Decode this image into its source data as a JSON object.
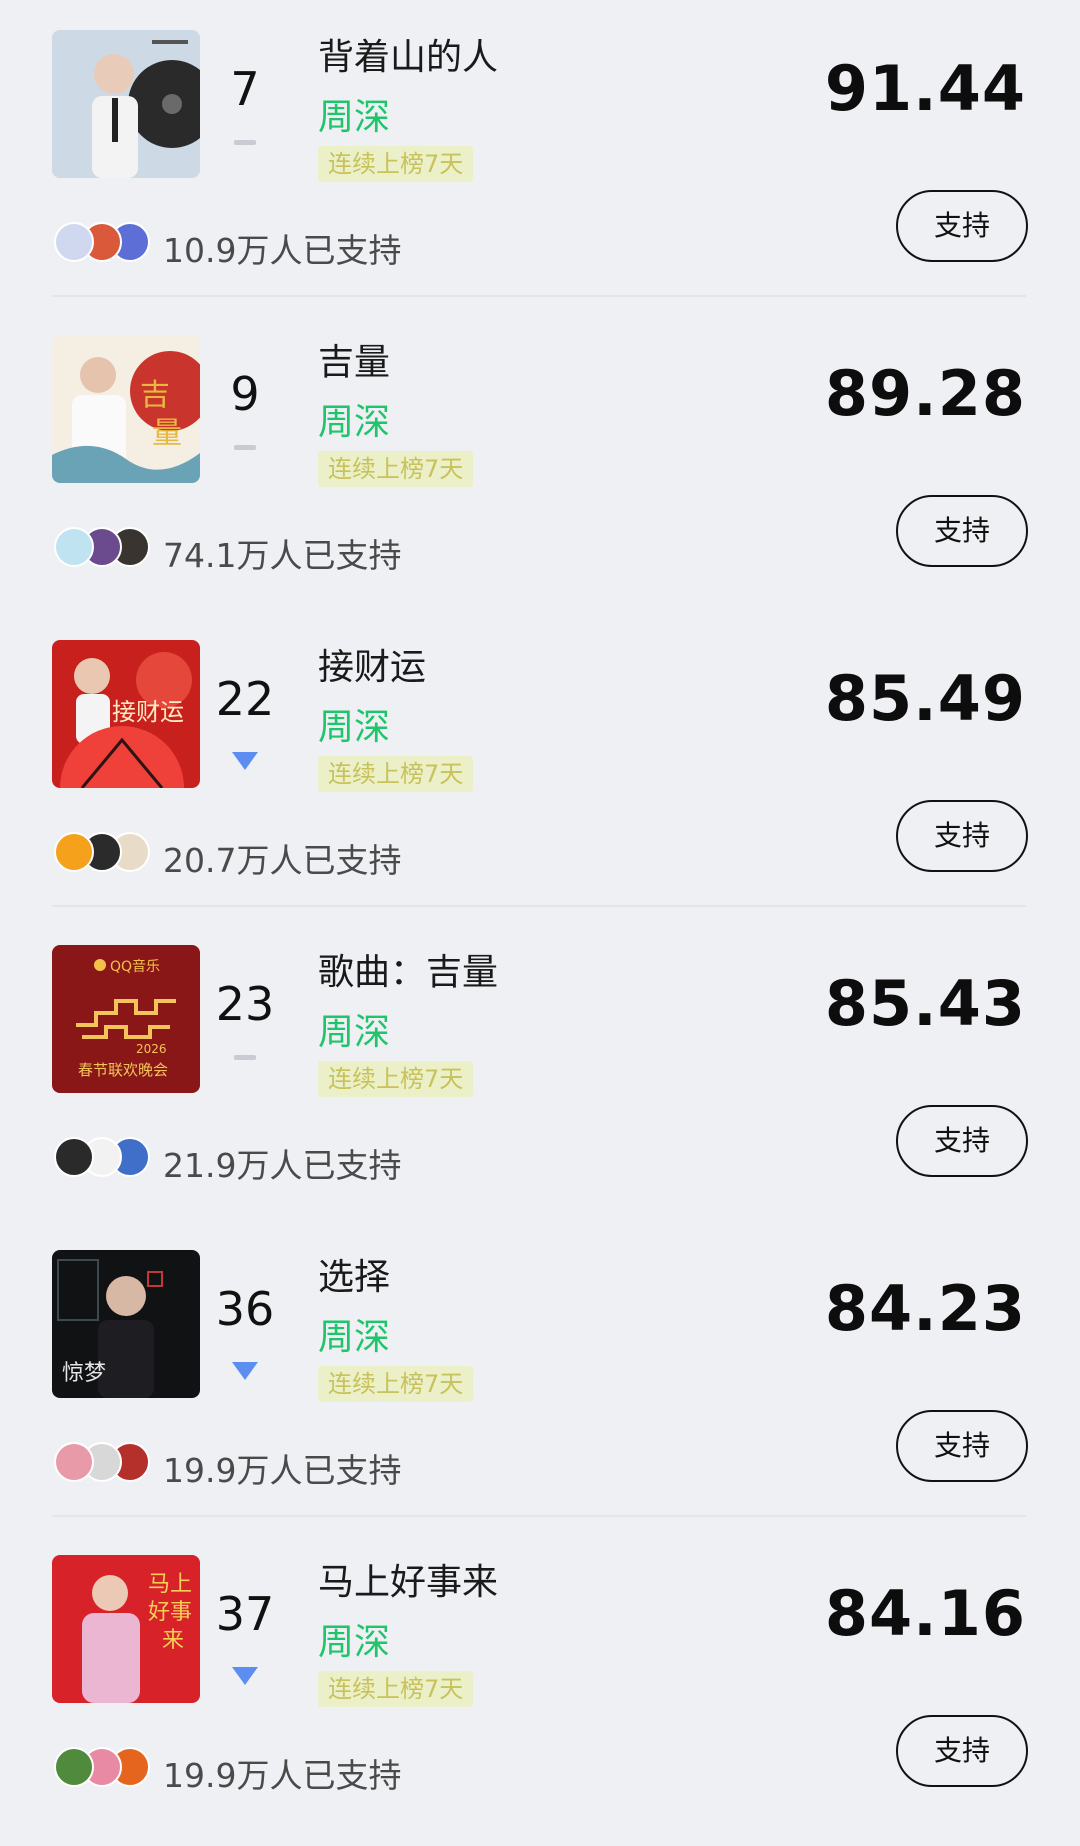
{
  "support_label": "支持",
  "colors": {
    "artist": "#20c46b",
    "streak_bg": "#ecf0c8",
    "streak_text": "#c8c25a",
    "trend_down": "#5b8ef0",
    "background": "#eef0f4"
  },
  "entries": [
    {
      "rank": "7",
      "trend": "flat",
      "song": "背着山的人",
      "artist": "周深",
      "streak": "连续上榜7天",
      "score": "91.44",
      "supporters": "10.9万人已支持",
      "cover": "portrait-cover-beizheshan"
    },
    {
      "rank": "9",
      "trend": "flat",
      "song": "吉量",
      "artist": "周深",
      "streak": "连续上榜7天",
      "score": "89.28",
      "supporters": "74.1万人已支持",
      "cover": "portrait-cover-jiliang"
    },
    {
      "rank": "22",
      "trend": "down",
      "song": "接财运",
      "artist": "周深",
      "streak": "连续上榜7天",
      "score": "85.49",
      "supporters": "20.7万人已支持",
      "cover": "portrait-cover-jiecaiyun"
    },
    {
      "rank": "23",
      "trend": "flat",
      "song": "歌曲：吉量",
      "artist": "周深",
      "streak": "连续上榜7天",
      "score": "85.43",
      "supporters": "21.9万人已支持",
      "cover": "qq-music-gala-cover"
    },
    {
      "rank": "36",
      "trend": "down",
      "song": "选择",
      "artist": "周深",
      "streak": "连续上榜7天",
      "score": "84.23",
      "supporters": "19.9万人已支持",
      "cover": "portrait-cover-xuanze"
    },
    {
      "rank": "37",
      "trend": "down",
      "song": "马上好事来",
      "artist": "周深",
      "streak": "连续上榜7天",
      "score": "84.16",
      "supporters": "19.9万人已支持",
      "cover": "portrait-cover-mashang"
    }
  ]
}
